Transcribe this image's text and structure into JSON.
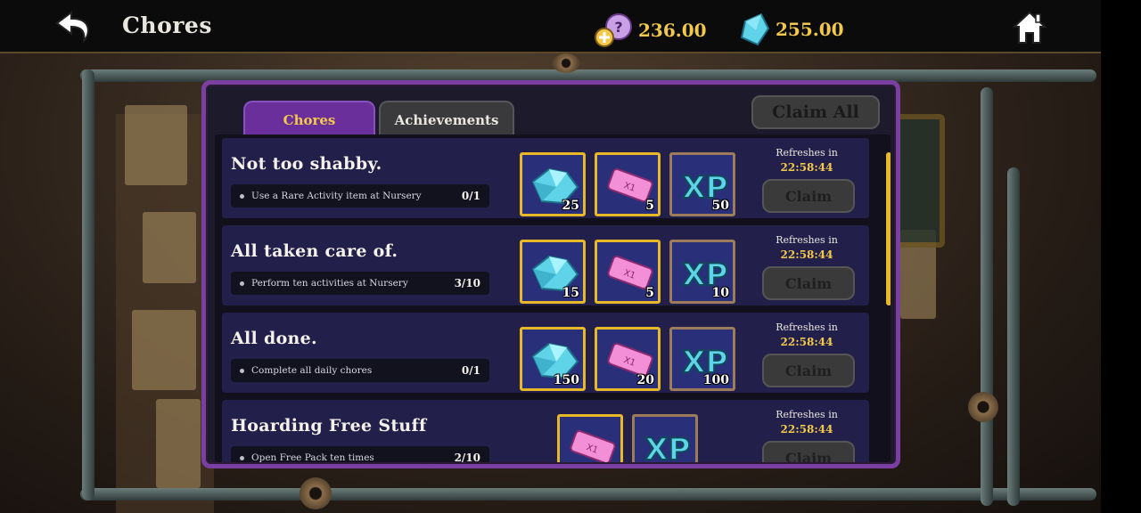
{
  "header": {
    "title": "Chores",
    "currency_coin": "236.00",
    "currency_gem": "255.00"
  },
  "tabs": [
    {
      "label": "Chores",
      "active": true
    },
    {
      "label": "Achievements",
      "active": false
    }
  ],
  "claim_all_label": "Claim All",
  "chores": [
    {
      "title": "Not too shabby.",
      "task": "Use a Rare Activity item at Nursery",
      "progress": "0/1",
      "rewards": [
        {
          "type": "gem",
          "amount": "25"
        },
        {
          "type": "ticket",
          "amount": "5"
        },
        {
          "type": "xp",
          "amount": "50"
        }
      ],
      "refresh_label": "Refreshes in",
      "refresh_time": "22:58:44",
      "claim_label": "Claim"
    },
    {
      "title": "All taken care of.",
      "task": "Perform ten activities at Nursery",
      "progress": "3/10",
      "rewards": [
        {
          "type": "gem",
          "amount": "15"
        },
        {
          "type": "ticket",
          "amount": "5"
        },
        {
          "type": "xp",
          "amount": "10"
        }
      ],
      "refresh_label": "Refreshes in",
      "refresh_time": "22:58:44",
      "claim_label": "Claim"
    },
    {
      "title": "All done.",
      "task": "Complete all daily chores",
      "progress": "0/1",
      "rewards": [
        {
          "type": "gem",
          "amount": "150"
        },
        {
          "type": "ticket",
          "amount": "20"
        },
        {
          "type": "xp",
          "amount": "100"
        }
      ],
      "refresh_label": "Refreshes in",
      "refresh_time": "22:58:44",
      "claim_label": "Claim"
    },
    {
      "title": "Hoarding Free Stuff",
      "task": "Open Free Pack ten times",
      "progress": "2/10",
      "rewards": [
        {
          "type": "ticket",
          "amount": ""
        },
        {
          "type": "xp",
          "amount": ""
        }
      ],
      "refresh_label": "Refreshes in",
      "refresh_time": "22:58:44",
      "claim_label": "Claim"
    }
  ],
  "colors": {
    "panel_border": "#7a3fa0",
    "active_tab": "#6a2f9a",
    "gold": "#f2c94c",
    "row_bg": "#22204a"
  }
}
